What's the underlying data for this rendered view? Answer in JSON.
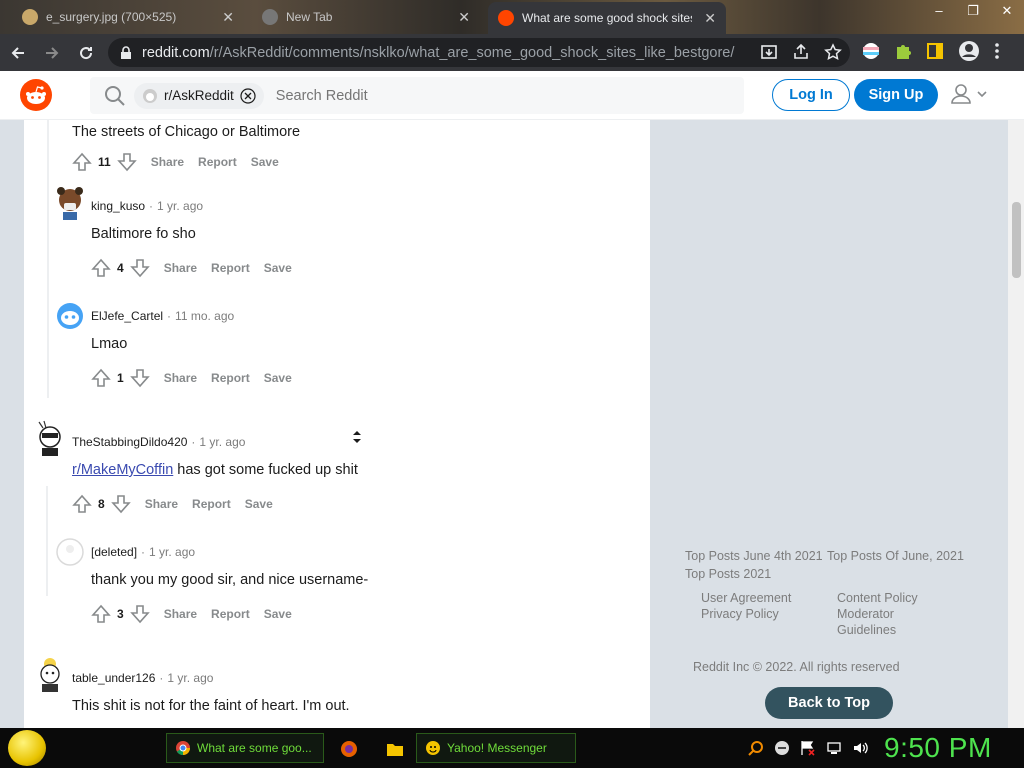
{
  "browser": {
    "tabs": [
      {
        "label": "e_surgery.jpg (700×525)",
        "active": false
      },
      {
        "label": "New Tab",
        "active": false
      },
      {
        "label": "What are some good shock sites",
        "active": true
      }
    ],
    "url_host": "reddit.com",
    "url_path": "/r/AskReddit/comments/nsklko/what_are_some_good_shock_sites_like_bestgore/"
  },
  "header": {
    "subreddit_chip": "r/AskReddit",
    "search_placeholder": "Search Reddit",
    "login_label": "Log In",
    "signup_label": "Sign Up"
  },
  "comments": [
    {
      "body": "The streets of Chicago or Baltimore",
      "score": "11"
    },
    {
      "user": "king_kuso",
      "age": "1 yr. ago",
      "body": "Baltimore fo sho",
      "score": "4"
    },
    {
      "user": "ElJefe_Cartel",
      "age": "11 mo. ago",
      "body": "Lmao",
      "score": "1"
    },
    {
      "user": "TheStabbingDildo420",
      "age": "1 yr. ago",
      "body_link": "r/MakeMyCoffin",
      "body": " has got some fucked up shit",
      "score": "8"
    },
    {
      "user": "[deleted]",
      "age": "1 yr. ago",
      "body": "thank you my good sir, and nice username-",
      "score": "3"
    },
    {
      "user": "table_under126",
      "age": "1 yr. ago",
      "body": "This shit is not for the faint of heart. I'm out."
    }
  ],
  "actions": {
    "share": "Share",
    "report": "Report",
    "save": "Save",
    "dot": "·"
  },
  "sidebar": {
    "top_posts": [
      "Top Posts June 4th 2021",
      "Top Posts Of June, 2021",
      "Top Posts 2021"
    ],
    "links": [
      "User Agreement",
      "Privacy Policy",
      "Content Policy",
      "Moderator",
      "Guidelines"
    ],
    "copyright": "Reddit Inc © 2022. All rights reserved",
    "back_to_top": "Back to Top"
  },
  "taskbar": {
    "items": [
      "What are some goo...",
      "Yahoo! Messenger"
    ],
    "clock": "9:50 PM"
  },
  "colors": {
    "reddit_orange": "#ff4500",
    "reddit_blue": "#0079d3",
    "clock_green": "#4ee34e"
  }
}
